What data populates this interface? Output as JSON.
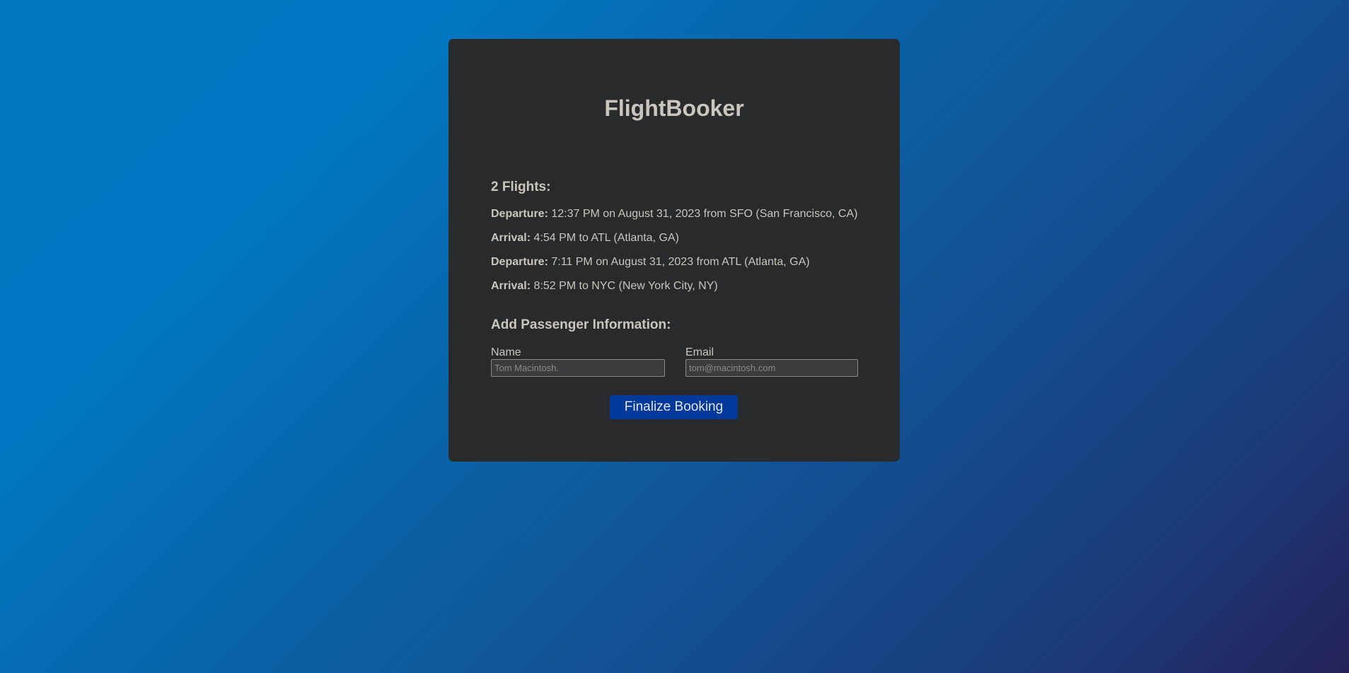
{
  "app": {
    "title": "FlightBooker"
  },
  "flights": {
    "heading": "2 Flights:",
    "legs": [
      {
        "label": "Departure:",
        "text": " 12:37 PM on August 31, 2023 from SFO (San Francisco, CA)"
      },
      {
        "label": "Arrival:",
        "text": " 4:54 PM to ATL (Atlanta, GA)"
      },
      {
        "label": "Departure:",
        "text": " 7:11 PM on August 31, 2023 from ATL (Atlanta, GA)"
      },
      {
        "label": "Arrival:",
        "text": " 8:52 PM to NYC (New York City, NY)"
      }
    ]
  },
  "passenger": {
    "heading": "Add Passenger Information:",
    "name": {
      "label": "Name",
      "value": "",
      "placeholder": "Tom Macintosh."
    },
    "email": {
      "label": "Email",
      "value": "",
      "placeholder": "tom@macintosh.com"
    }
  },
  "actions": {
    "finalize_label": "Finalize Booking"
  },
  "colors": {
    "card_background": "#282a2b",
    "text": "#cbc6bd",
    "button": "#03399a",
    "background_start": "#0076c0",
    "background_end": "#25225a"
  }
}
